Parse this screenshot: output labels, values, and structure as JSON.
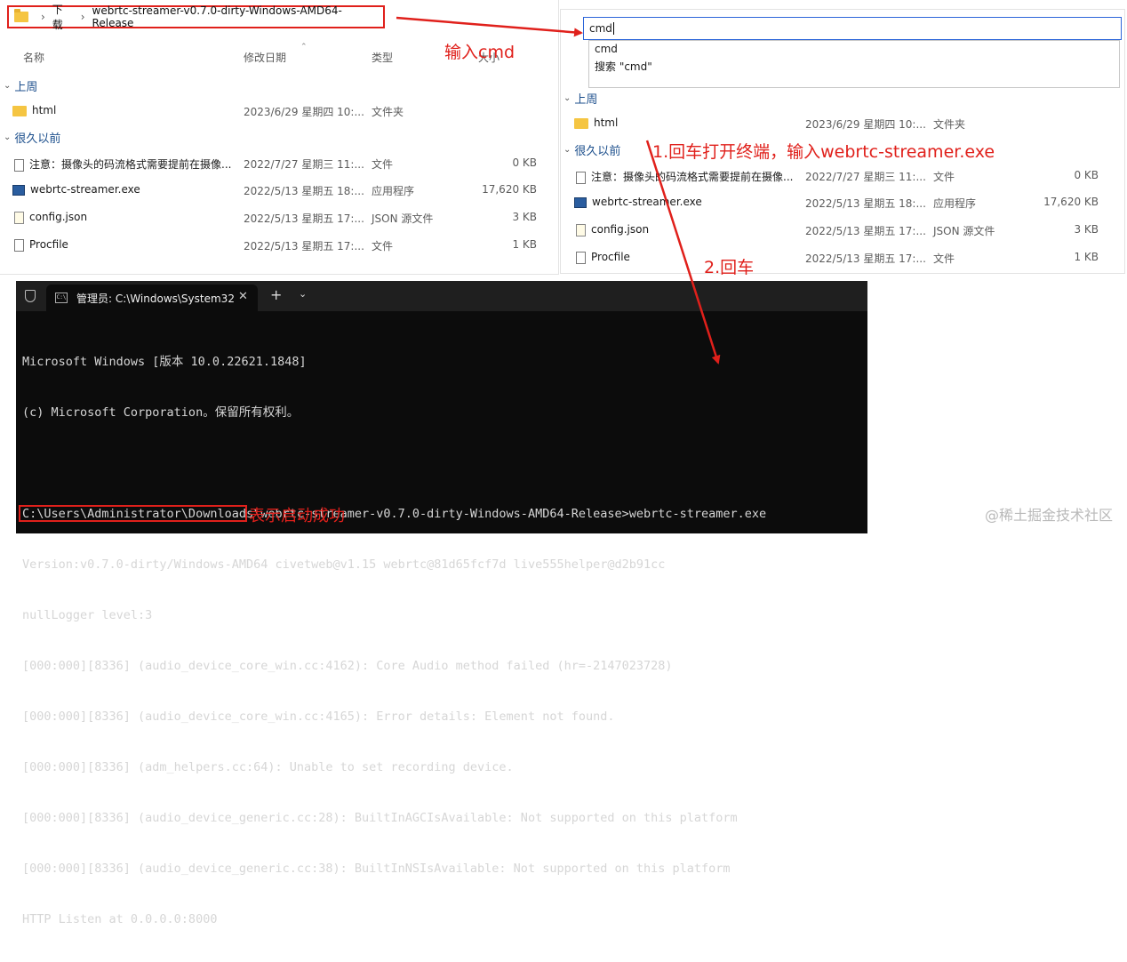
{
  "explorer_left": {
    "breadcrumb": [
      "下载",
      "webrtc-streamer-v0.7.0-dirty-Windows-AMD64-Release"
    ],
    "columns": [
      "名称",
      "修改日期",
      "类型",
      "大小"
    ],
    "groups": [
      "上周",
      "很久以前"
    ],
    "rows": [
      {
        "name": "html",
        "date": "2023/6/29 星期四 10:...",
        "type": "文件夹",
        "size": "",
        "icon": "folder-icon"
      },
      {
        "name": "注意：摄像头的码流格式需要提前在摄像...",
        "date": "2022/7/27 星期三 11:...",
        "type": "文件",
        "size": "0 KB",
        "icon": "file-icon"
      },
      {
        "name": "webrtc-streamer.exe",
        "date": "2022/5/13 星期五 18:...",
        "type": "应用程序",
        "size": "17,620 KB",
        "icon": "exe-icon"
      },
      {
        "name": "config.json",
        "date": "2022/5/13 星期五 17:...",
        "type": "JSON 源文件",
        "size": "3 KB",
        "icon": "json-icon"
      },
      {
        "name": "Procfile",
        "date": "2022/5/13 星期五 17:...",
        "type": "文件",
        "size": "1 KB",
        "icon": "file-icon"
      }
    ]
  },
  "explorer_right": {
    "address_value": "cmd",
    "suggestions": [
      "cmd",
      "搜索 \"cmd\""
    ],
    "groups": [
      "上周",
      "很久以前"
    ],
    "rows": [
      {
        "name": "html",
        "date": "2023/6/29 星期四 10:...",
        "type": "文件夹",
        "size": ""
      },
      {
        "name": "注意：摄像头的码流格式需要提前在摄像...",
        "date": "2022/7/27 星期三 11:...",
        "type": "文件",
        "size": "0 KB"
      },
      {
        "name": "webrtc-streamer.exe",
        "date": "2022/5/13 星期五 18:...",
        "type": "应用程序",
        "size": "17,620 KB"
      },
      {
        "name": "config.json",
        "date": "2022/5/13 星期五 17:...",
        "type": "JSON 源文件",
        "size": "3 KB"
      },
      {
        "name": "Procfile",
        "date": "2022/5/13 星期五 17:...",
        "type": "文件",
        "size": "1 KB"
      }
    ]
  },
  "terminal": {
    "tab_title": "管理员: C:\\Windows\\System32",
    "tab_close": "✕",
    "new_tab": "+",
    "dropdown": "⌄",
    "lines": [
      "Microsoft Windows [版本 10.0.22621.1848]",
      "(c) Microsoft Corporation。保留所有权利。",
      "",
      "C:\\Users\\Administrator\\Downloads\\webrtc-streamer-v0.7.0-dirty-Windows-AMD64-Release>webrtc-streamer.exe",
      "Version:v0.7.0-dirty/Windows-AMD64 civetweb@v1.15 webrtc@81d65fcf7d live555helper@d2b91cc",
      "nullLogger level:3",
      "[000:000][8336] (audio_device_core_win.cc:4162): Core Audio method failed (hr=-2147023728)",
      "[000:000][8336] (audio_device_core_win.cc:4165): Error details: Element not found.",
      "[000:000][8336] (adm_helpers.cc:64): Unable to set recording device.",
      "[000:000][8336] (audio_device_generic.cc:28): BuiltInAGCIsAvailable: Not supported on this platform",
      "[000:000][8336] (audio_device_generic.cc:38): BuiltInNSIsAvailable: Not supported on this platform",
      "HTTP Listen at 0.0.0.0:8000"
    ]
  },
  "annotations": {
    "input_cmd": "输入cmd",
    "step1": "1.回车打开终端，输入webrtc-streamer.exe",
    "step2": "2.回车",
    "success": "表示启动成功",
    "color": "#e0201b"
  },
  "watermark": "@稀土掘金技术社区"
}
